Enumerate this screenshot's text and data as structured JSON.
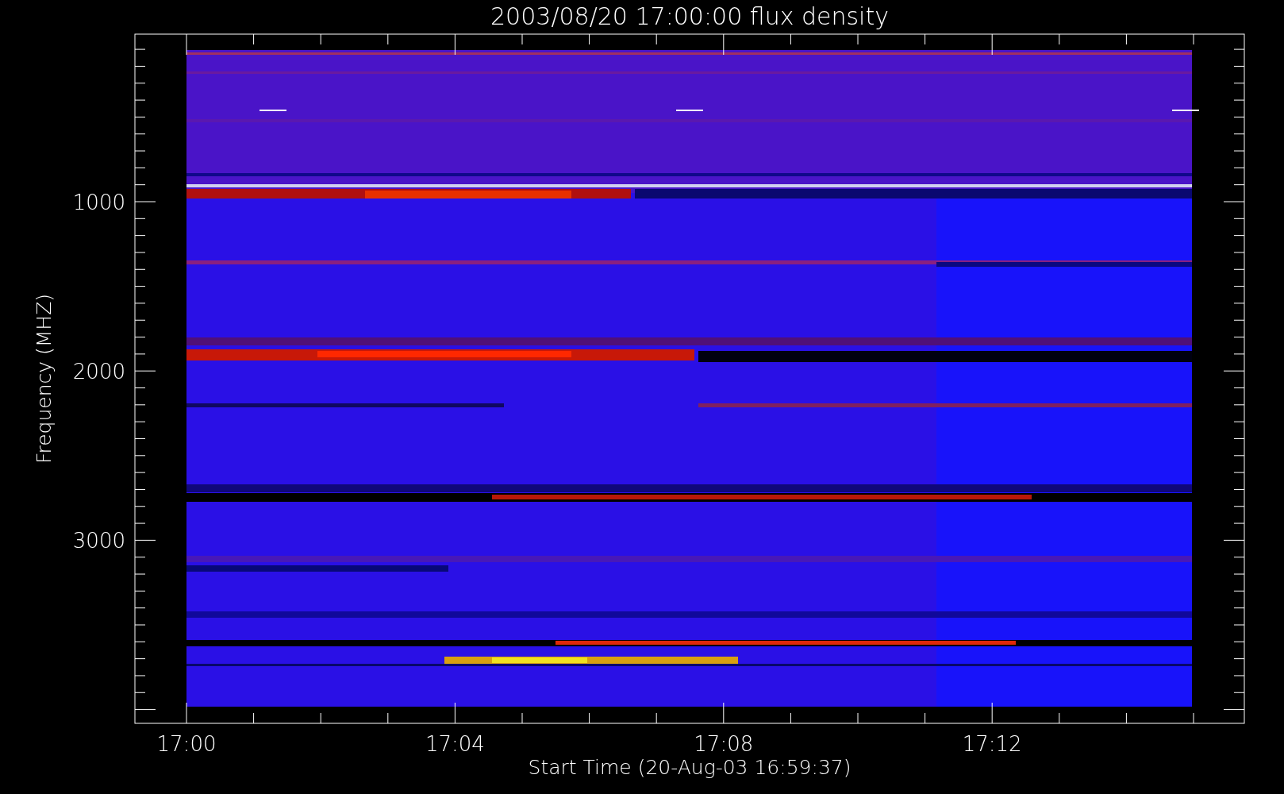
{
  "title": "2003/08/20 17:00:00 flux density",
  "y_axis": {
    "label": "Frequency (MHZ)",
    "tick_labels": [
      "1000",
      "2000",
      "3000"
    ]
  },
  "x_axis": {
    "label": "Start Time (20-Aug-03 16:59:37)",
    "tick_labels": [
      "17:00",
      "17:04",
      "17:08",
      "17:12"
    ]
  }
}
